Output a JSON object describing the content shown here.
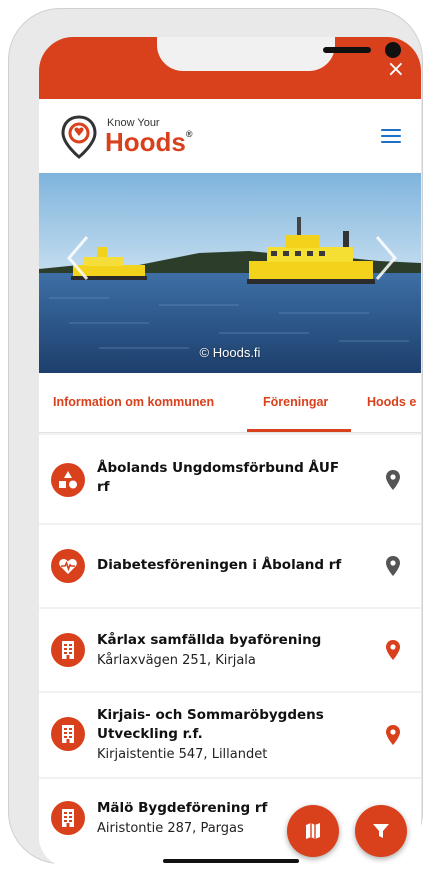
{
  "app": {
    "close_symbol": "×",
    "logo": {
      "small": "Know Your",
      "big": "Hoods",
      "mark": "®"
    }
  },
  "hero": {
    "caption": "© Hoods.fi",
    "colors": {
      "sky": "#9ec7e6",
      "water": "#2f5f95",
      "ferry": "#f2d21a"
    }
  },
  "tabs": [
    {
      "label": "Information om kommunen",
      "active": false
    },
    {
      "label": "Föreningar",
      "active": true
    },
    {
      "label": "Hoods e",
      "active": false
    }
  ],
  "list": [
    {
      "title": "Åbolands Ungdomsförbund ÅUF rf",
      "subtitle": "",
      "icon": "shapes-icon",
      "pin": "gray"
    },
    {
      "title": "Diabetesföreningen i Åboland rf",
      "subtitle": "",
      "icon": "heart-pulse-icon",
      "pin": "gray"
    },
    {
      "title": "Kårlax samfällda byaförening",
      "subtitle": "Kårlaxvägen 251, Kirjala",
      "icon": "building-icon",
      "pin": "red"
    },
    {
      "title": "Kirjais- och Sommaröbygdens Utveckling r.f.",
      "subtitle": "Kirjaistentie 547, Lillandet",
      "icon": "building-icon",
      "pin": "red"
    },
    {
      "title": "Mälö Bygdeförening rf",
      "subtitle": "Airistontie 287, Pargas",
      "icon": "building-icon",
      "pin": "red"
    }
  ],
  "theme": {
    "accent": "#d9401c",
    "menu": "#1f6fc7",
    "pin_gray": "#555555",
    "pin_red": "#d9401c"
  }
}
